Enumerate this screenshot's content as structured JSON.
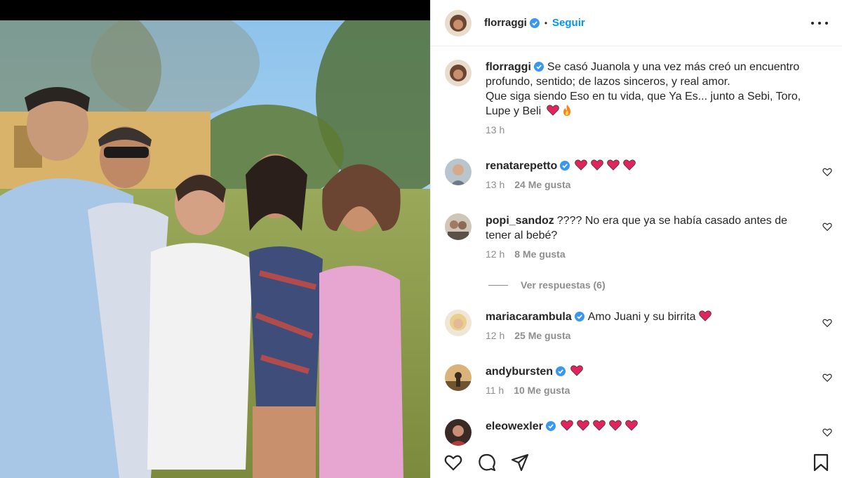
{
  "post": {
    "author": "florraggi",
    "follow_label": "Seguir",
    "separator": "•",
    "caption_lines": [
      "Se casó Juanola y una vez más creó un encuentro",
      "profundo, sentido; de lazos sinceros, y real amor.",
      "Que siga siendo Eso en tu vida, que Ya Es... junto a Sebi, Toro,",
      "Lupe y Beli"
    ],
    "caption_time": "13 h"
  },
  "comments": [
    {
      "user": "renatarepetto",
      "verified": true,
      "text": "",
      "hearts": 4,
      "time": "13 h",
      "likes": "24 Me gusta"
    },
    {
      "user": "popi_sandoz",
      "verified": false,
      "text_lines": [
        "???? No era que ya se había casado antes de",
        "tener al bebé?"
      ],
      "time": "12 h",
      "likes": "8 Me gusta",
      "replies_label": "Ver respuestas (6)"
    },
    {
      "user": "mariacarambula",
      "verified": true,
      "text": "Amo Juani y su birrita",
      "hearts": 1,
      "time": "12 h",
      "likes": "25 Me gusta"
    },
    {
      "user": "andybursten",
      "verified": true,
      "text": "",
      "hearts": 1,
      "time": "11 h",
      "likes": "10 Me gusta"
    },
    {
      "user": "eleowexler",
      "verified": true,
      "text": "",
      "hearts": 5
    }
  ],
  "icons": {
    "like": "heart-icon",
    "comment": "comment-icon",
    "share": "share-icon",
    "save": "bookmark-icon",
    "more": "more-options-icon",
    "verified": "verified-badge-icon",
    "like_comment": "heart-outline-icon"
  },
  "colors": {
    "accent": "#0095f6",
    "verified": "#3897f0",
    "heart": "#e0245e",
    "muted": "#8e8e8e"
  }
}
